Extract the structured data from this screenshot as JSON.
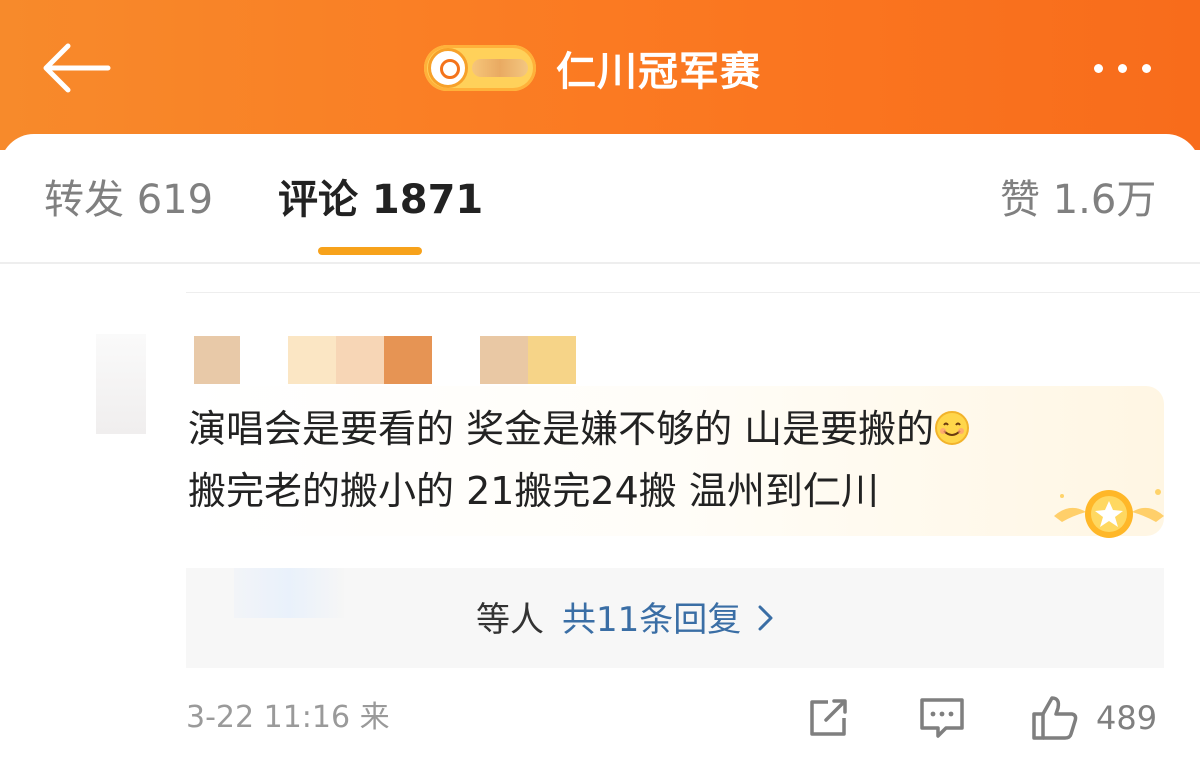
{
  "header": {
    "title": "仁川冠军赛",
    "back_icon": "arrow-left-icon",
    "more_icon": "more-dots-icon",
    "badge_icon": "super-topic-search-icon"
  },
  "tabs": [
    {
      "label": "转发 619"
    },
    {
      "label": "评论 1871",
      "active": true
    },
    {
      "label": "赞 1.6万"
    }
  ],
  "comment": {
    "text_line1": "演唱会是要看的 奖金是嫌不够的 山是要搬的",
    "text_line2": "搬完老的搬小的 21搬完24搬 温州到仁川",
    "emoji_icon": "smile-emoji-icon",
    "badge_icon": "star-medal-icon",
    "replies": {
      "users_suffix": "等人",
      "count_label": "共11条回复"
    },
    "meta": {
      "time": "3-22 11:16 来"
    },
    "actions": {
      "like_count": "489"
    }
  },
  "colors": {
    "header_bg": "#fb7a22",
    "tab_underline": "#f7a21b",
    "reply_link": "#3a6ea5"
  }
}
